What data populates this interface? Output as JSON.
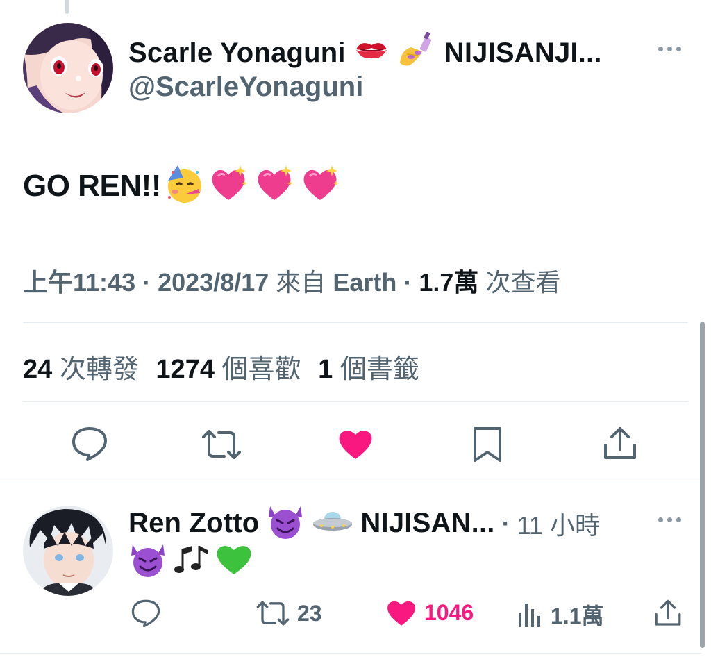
{
  "main_tweet": {
    "display_name": "Scarle Yonaguni",
    "name_suffix": "NIJISANJI...",
    "handle": "@ScarleYonaguni",
    "text": "GO REN!!",
    "time": "上午11:43",
    "separator": "·",
    "date": "2023/8/17",
    "source_prefix": "來自",
    "source": "Earth",
    "views_count": "1.7萬",
    "views_label": "次查看",
    "retweets_count": "24",
    "retweets_label": "次轉發",
    "likes_count": "1274",
    "likes_label": "個喜歡",
    "bookmarks_count": "1",
    "bookmarks_label": "個書籤"
  },
  "reply": {
    "display_name": "Ren Zotto",
    "name_suffix": "NIJISAN...",
    "separator": "·",
    "time_ago": "11 小時",
    "retweets": "23",
    "likes": "1046",
    "views": "1.1萬"
  },
  "colors": {
    "like_pink": "#f91880",
    "muted": "#536471",
    "divider": "#e6ecf0"
  },
  "icons": [
    "more-icon",
    "reply-icon",
    "retweet-icon",
    "heart-icon",
    "bookmark-icon",
    "share-icon",
    "views-icon",
    "kiss-mark-emoji",
    "nail-polish-emoji",
    "partying-face-emoji",
    "sparkling-heart-emoji",
    "smiling-devil-emoji",
    "flying-saucer-emoji",
    "music-notes-emoji",
    "green-heart-emoji"
  ]
}
